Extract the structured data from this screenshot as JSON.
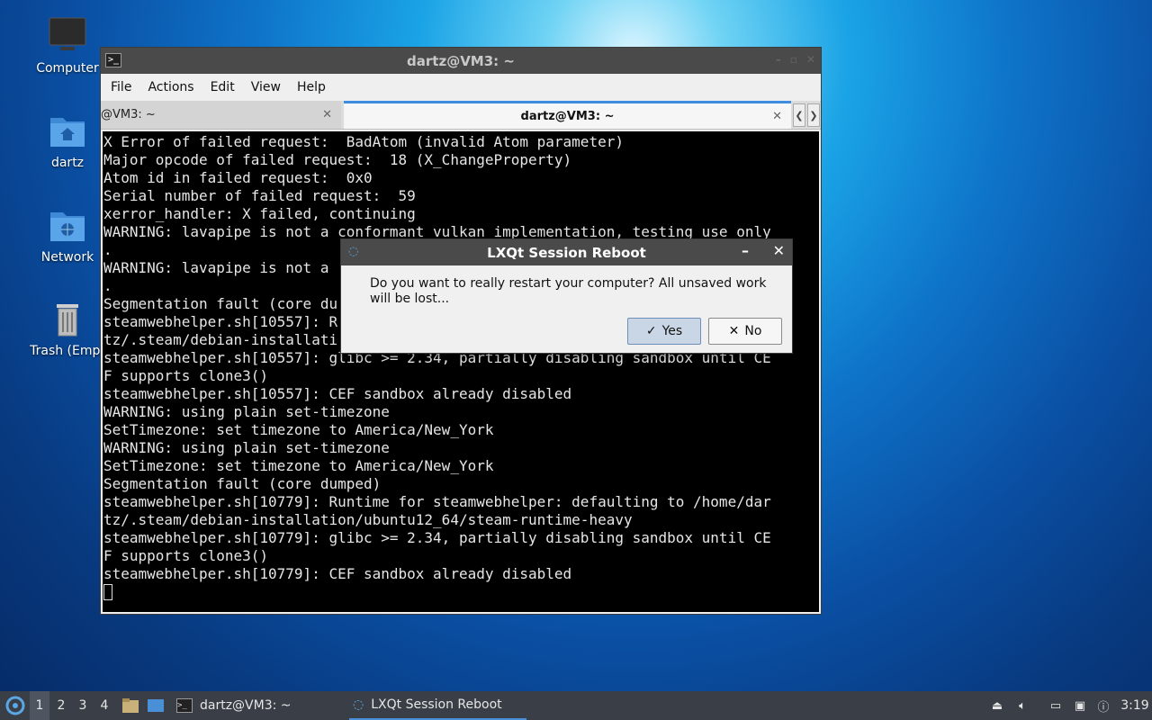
{
  "desktop": {
    "icons": [
      {
        "label": "Computer"
      },
      {
        "label": "dartz"
      },
      {
        "label": "Network"
      },
      {
        "label": "Trash (Empt"
      }
    ]
  },
  "terminal": {
    "title": "dartz@VM3: ~",
    "menu": [
      "File",
      "Actions",
      "Edit",
      "View",
      "Help"
    ],
    "tabs": [
      {
        "label": "@VM3: ~"
      },
      {
        "label": "dartz@VM3: ~"
      }
    ],
    "lines": [
      "X Error of failed request:  BadAtom (invalid Atom parameter)",
      "Major opcode of failed request:  18 (X_ChangeProperty)",
      "Atom id in failed request:  0x0",
      "Serial number of failed request:  59",
      "xerror_handler: X failed, continuing",
      "WARNING: lavapipe is not a conformant vulkan implementation, testing use only",
      ".",
      "WARNING: lavapipe is not a",
      ".",
      "Segmentation fault (core du",
      "steamwebhelper.sh[10557]: R",
      "tz/.steam/debian-installati",
      "steamwebhelper.sh[10557]: glibc >= 2.34, partially disabling sandbox until CE",
      "F supports clone3()",
      "steamwebhelper.sh[10557]: CEF sandbox already disabled",
      "WARNING: using plain set-timezone",
      "SetTimezone: set timezone to America/New_York",
      "WARNING: using plain set-timezone",
      "SetTimezone: set timezone to America/New_York",
      "Segmentation fault (core dumped)",
      "steamwebhelper.sh[10779]: Runtime for steamwebhelper: defaulting to /home/dar",
      "tz/.steam/debian-installation/ubuntu12_64/steam-runtime-heavy",
      "steamwebhelper.sh[10779]: glibc >= 2.34, partially disabling sandbox until CE",
      "F supports clone3()",
      "steamwebhelper.sh[10779]: CEF sandbox already disabled"
    ]
  },
  "dialog": {
    "title": "LXQt Session Reboot",
    "message": "Do you want to really restart your computer? All unsaved work will be lost...",
    "yes_label": "Yes",
    "no_label": "No"
  },
  "taskbar": {
    "desktops": [
      "1",
      "2",
      "3",
      "4"
    ],
    "tasks": [
      {
        "label": "dartz@VM3: ~"
      },
      {
        "label": "LXQt Session Reboot"
      }
    ],
    "clock": "3:19"
  }
}
